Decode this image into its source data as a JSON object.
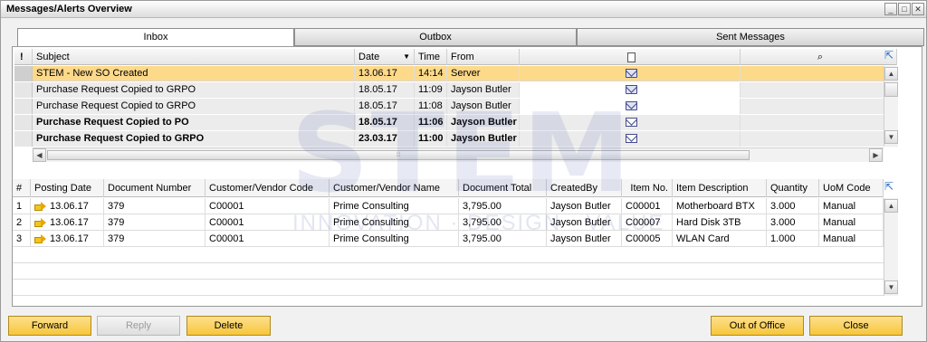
{
  "window": {
    "title": "Messages/Alerts Overview"
  },
  "tabs": [
    {
      "label": "Inbox"
    },
    {
      "label": "Outbox"
    },
    {
      "label": "Sent Messages"
    }
  ],
  "inbox": {
    "columns": {
      "flag": "!",
      "subject": "Subject",
      "date": "Date",
      "time": "Time",
      "from": "From"
    },
    "rows": [
      {
        "subject": "STEM - New SO Created",
        "date": "13.06.17",
        "time": "14:14",
        "from": "Server",
        "read": true,
        "bold": false,
        "selected": true
      },
      {
        "subject": "Purchase Request Copied to GRPO",
        "date": "18.05.17",
        "time": "11:09",
        "from": "Jayson Butler",
        "read": true,
        "bold": false,
        "selected": false
      },
      {
        "subject": "Purchase Request Copied to GRPO",
        "date": "18.05.17",
        "time": "11:08",
        "from": "Jayson Butler",
        "read": true,
        "bold": false,
        "selected": false
      },
      {
        "subject": "Purchase Request Copied to PO",
        "date": "18.05.17",
        "time": "11:06",
        "from": "Jayson Butler",
        "read": false,
        "bold": true,
        "selected": false
      },
      {
        "subject": "Purchase Request Copied to GRPO",
        "date": "23.03.17",
        "time": "11:00",
        "from": "Jayson Butler",
        "read": false,
        "bold": true,
        "selected": false
      }
    ]
  },
  "details": {
    "columns": [
      "#",
      "Posting Date",
      "Document Number",
      "Customer/Vendor Code",
      "Customer/Vendor Name",
      "Document Total",
      "CreatedBy",
      "Item No.",
      "Item Description",
      "Quantity",
      "UoM Code"
    ],
    "rows": [
      [
        "1",
        "13.06.17",
        "379",
        "C00001",
        "Prime Consulting",
        "3,795.00",
        "Jayson Butler",
        "C00001",
        "Motherboard BTX",
        "3.000",
        "Manual"
      ],
      [
        "2",
        "13.06.17",
        "379",
        "C00001",
        "Prime Consulting",
        "3,795.00",
        "Jayson Butler",
        "C00007",
        "Hard Disk 3TB",
        "3.000",
        "Manual"
      ],
      [
        "3",
        "13.06.17",
        "379",
        "C00001",
        "Prime Consulting",
        "3,795.00",
        "Jayson Butler",
        "C00005",
        "WLAN Card",
        "1.000",
        "Manual"
      ]
    ]
  },
  "buttons": {
    "forward": "Forward",
    "reply": "Reply",
    "delete": "Delete",
    "out_of_office": "Out of Office",
    "close": "Close"
  },
  "watermark": {
    "main": "STEM",
    "sub": "INNOVATION · DESIGN · VALUE"
  },
  "colors": {
    "selected_row": "#fdd98a",
    "button": "#f7c63b"
  }
}
